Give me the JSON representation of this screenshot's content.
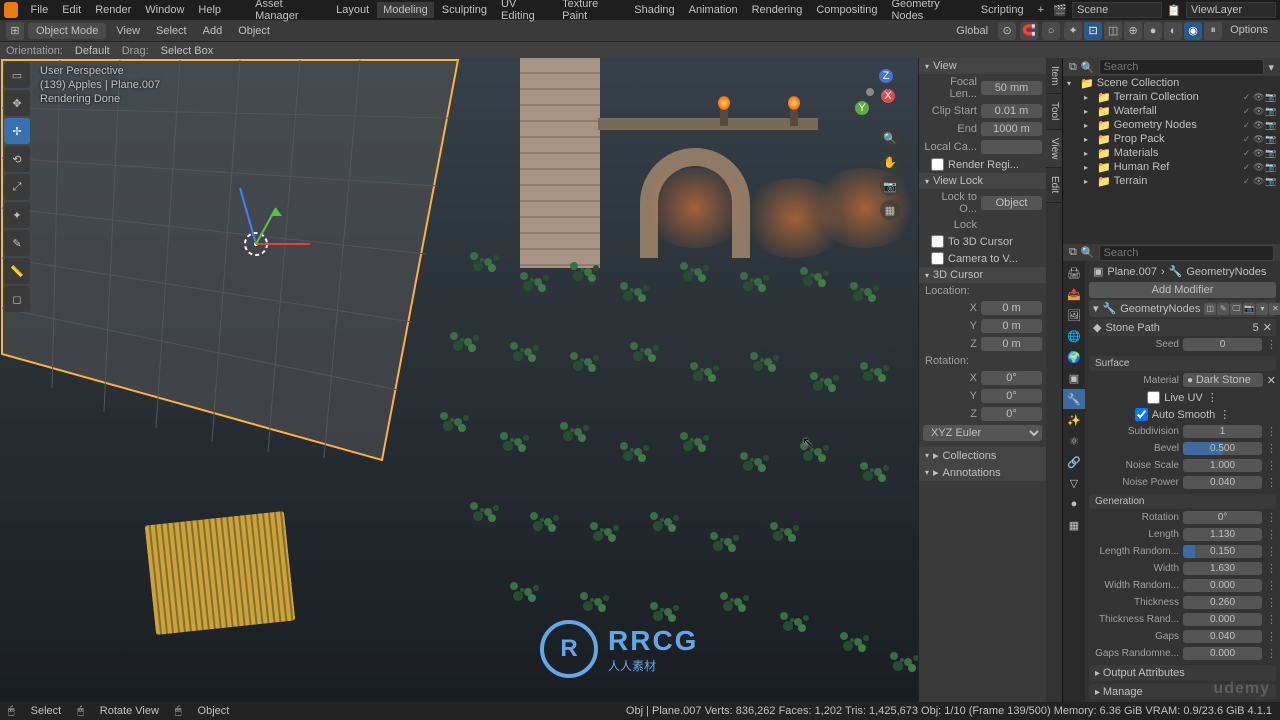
{
  "menubar": {
    "items": [
      "File",
      "Edit",
      "Render",
      "Window",
      "Help"
    ],
    "workspaces": [
      "Asset Manager",
      "Layout",
      "Modeling",
      "Sculpting",
      "UV Editing",
      "Texture Paint",
      "Shading",
      "Animation",
      "Rendering",
      "Compositing",
      "Geometry Nodes",
      "Scripting"
    ],
    "active_workspace": "Modeling",
    "scene_label": "Scene",
    "viewlayer_label": "ViewLayer"
  },
  "header": {
    "mode": "Object Mode",
    "menus": [
      "View",
      "Select",
      "Add",
      "Object"
    ],
    "orientation_label": "Global",
    "options_label": "Options"
  },
  "row3": {
    "orientation_label": "Orientation:",
    "orientation_value": "Default",
    "drag_label": "Drag:",
    "drag_value": "Select Box"
  },
  "viewport": {
    "info_line1": "User Perspective",
    "info_line2": "(139) Apples | Plane.007",
    "info_line3": "Rendering Done"
  },
  "npanel": {
    "view": {
      "header": "View",
      "focal_label": "Focal Len...",
      "focal_value": "50 mm",
      "clip_start_label": "Clip Start",
      "clip_start_value": "0.01 m",
      "end_label": "End",
      "end_value": "1000 m",
      "local_cam_label": "Local Ca...",
      "render_region_label": "Render Regi..."
    },
    "viewlock": {
      "header": "View Lock",
      "lock_to_label": "Lock to O...",
      "lock_to_placeholder": "Object",
      "lock_label": "Lock",
      "to_cursor": "To 3D Cursor",
      "cam_to_view": "Camera to V..."
    },
    "cursor3d": {
      "header": "3D Cursor",
      "location_label": "Location:",
      "x": "0 m",
      "y": "0 m",
      "z": "0 m",
      "rotation_label": "Rotation:",
      "rx": "0°",
      "ry": "0°",
      "rz": "0°",
      "mode": "XYZ Euler"
    },
    "collections_header": "Collections",
    "annotations_header": "Annotations",
    "tabs": [
      "Item",
      "Tool",
      "View",
      "Edit"
    ]
  },
  "outliner": {
    "search_placeholder": "Search",
    "root": "Scene Collection",
    "items": [
      {
        "name": "Terrain Collection",
        "expandable": true
      },
      {
        "name": "Waterfall",
        "expandable": true
      },
      {
        "name": "Geometry Nodes",
        "expandable": true
      },
      {
        "name": "Prop Pack",
        "expandable": true
      },
      {
        "name": "Materials",
        "expandable": true
      },
      {
        "name": "Human Ref",
        "expandable": true
      },
      {
        "name": "Terrain",
        "expandable": true
      }
    ]
  },
  "properties": {
    "search_placeholder": "Search",
    "crumb_obj": "Plane.007",
    "crumb_mod": "GeometryNodes",
    "add_modifier": "Add Modifier",
    "mod_name": "GeometryNodes",
    "node_group": "Stone Path",
    "node_group_users": "5",
    "seed_label": "Seed",
    "seed_value": "0",
    "surface_header": "Surface",
    "material_label": "Material",
    "material_value": "Dark Stone",
    "live_uv": "Live UV",
    "auto_smooth": "Auto Smooth",
    "subdivision_label": "Subdivision",
    "subdivision_value": "1",
    "bevel_label": "Bevel",
    "bevel_value": "0.500",
    "noise_scale_label": "Noise Scale",
    "noise_scale_value": "1.000",
    "noise_power_label": "Noise Power",
    "noise_power_value": "0.040",
    "generation_header": "Generation",
    "rotation_label": "Rotation",
    "rotation_value": "0°",
    "length_label": "Length",
    "length_value": "1.130",
    "length_random_label": "Length Random...",
    "length_random_value": "0.150",
    "width_label": "Width",
    "width_value": "1.630",
    "width_random_label": "Width Random...",
    "width_random_value": "0.000",
    "thickness_label": "Thickness",
    "thickness_value": "0.260",
    "thickness_rand_label": "Thickness Rand...",
    "thickness_rand_value": "0.000",
    "gaps_label": "Gaps",
    "gaps_value": "0.040",
    "gaps_random_label": "Gaps Randomne...",
    "gaps_random_value": "0.000",
    "output_attrs": "Output Attributes",
    "manage": "Manage"
  },
  "statusbar": {
    "select": "Select",
    "rotate": "Rotate View",
    "object": "Object",
    "stats": "Obj | Plane.007   Verts: 836,262   Faces: 1,202   Tris: 1,425,673   Obj: 1/10 (Frame 139/500)   Memory: 6.36 GiB   VRAM: 0.9/23.6 GiB   4.1.1"
  },
  "watermark": {
    "text": "RRCG",
    "sub": "人人素材"
  },
  "udemy": "udemy"
}
